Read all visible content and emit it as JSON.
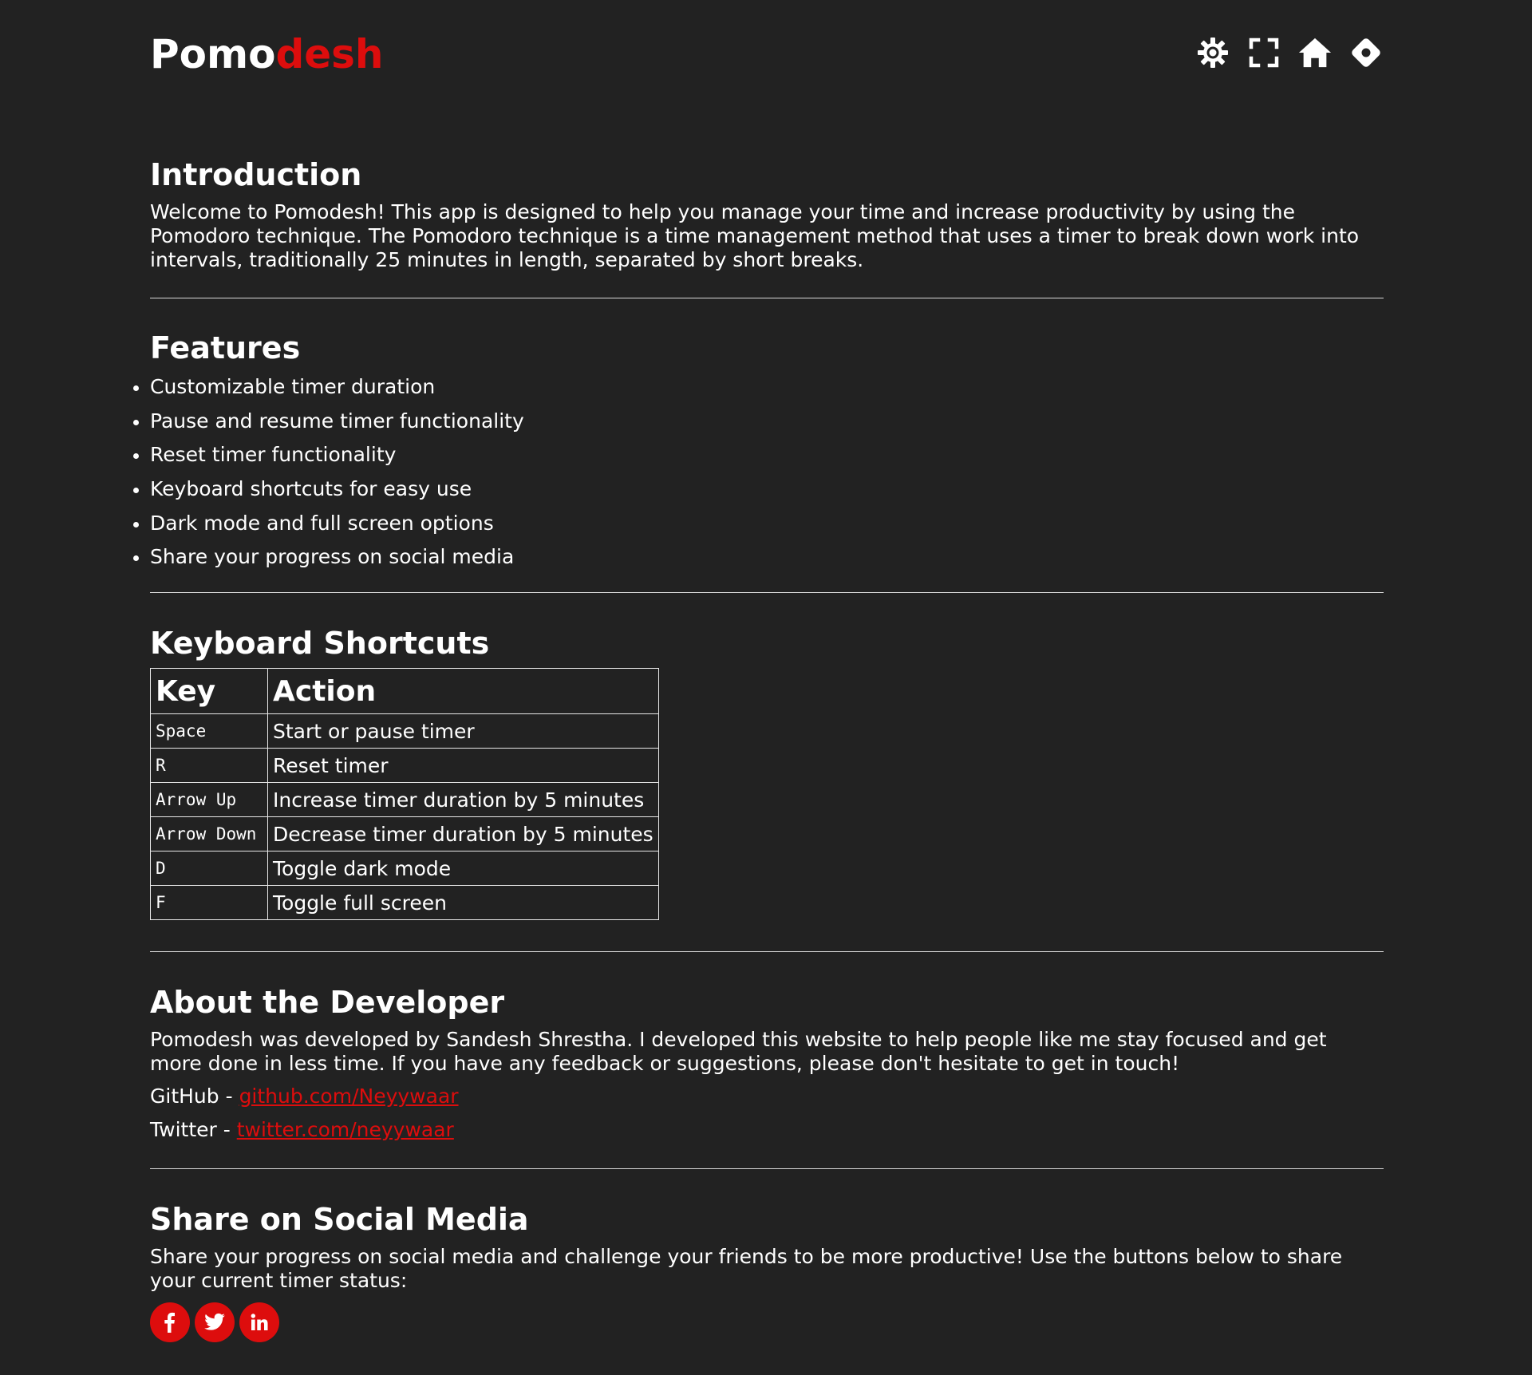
{
  "colors": {
    "background": "#222222",
    "text": "#ffffff",
    "accent": "#dd0d0d"
  },
  "header": {
    "logo_primary": "Pomo",
    "logo_accent": "desh",
    "icons": [
      "gear-icon",
      "fullscreen-icon",
      "home-icon",
      "location-icon"
    ]
  },
  "intro": {
    "title": "Introduction",
    "body": "Welcome to Pomodesh! This app is designed to help you manage your time and increase productivity by using the Pomodoro technique. The Pomodoro technique is a time management method that uses a timer to break down work into intervals, traditionally 25 minutes in length, separated by short breaks."
  },
  "features": {
    "title": "Features",
    "items": [
      "Customizable timer duration",
      "Pause and resume timer functionality",
      "Reset timer functionality",
      "Keyboard shortcuts for easy use",
      "Dark mode and full screen options",
      "Share your progress on social media"
    ]
  },
  "shortcuts": {
    "title": "Keyboard Shortcuts",
    "headers": [
      "Key",
      "Action"
    ],
    "rows": [
      {
        "key": "Space",
        "action": "Start or pause timer"
      },
      {
        "key": "R",
        "action": "Reset timer"
      },
      {
        "key": "Arrow Up",
        "action": "Increase timer duration by 5 minutes"
      },
      {
        "key": "Arrow Down",
        "action": "Decrease timer duration by 5 minutes"
      },
      {
        "key": "D",
        "action": "Toggle dark mode"
      },
      {
        "key": "F",
        "action": "Toggle full screen"
      }
    ]
  },
  "developer": {
    "title": "About the Developer",
    "body": "Pomodesh was developed by Sandesh Shrestha. I developed this website to help people like me stay focused and get more done in less time. If you have any feedback or suggestions, please don't hesitate to get in touch!",
    "github_label": "GitHub - ",
    "github_link": "github.com/Neyywaar",
    "twitter_label": "Twitter - ",
    "twitter_link": "twitter.com/neyywaar"
  },
  "share": {
    "title": "Share on Social Media",
    "body": "Share your progress on social media and challenge your friends to be more productive! Use the buttons below to share your current timer status:",
    "buttons": [
      "facebook-icon",
      "twitter-icon",
      "linkedin-icon"
    ]
  }
}
